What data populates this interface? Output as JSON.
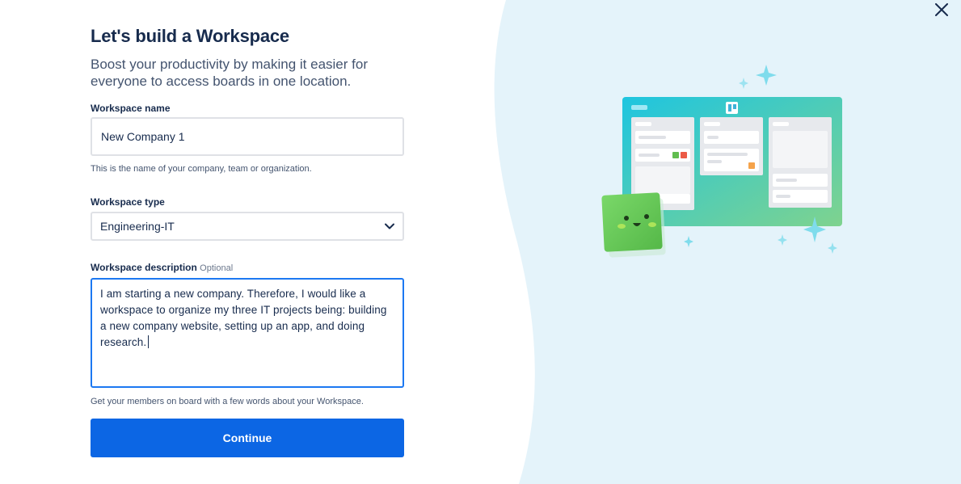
{
  "header": {
    "title": "Let's build a Workspace",
    "subtitle": "Boost your productivity by making it easier for everyone to access boards in one location."
  },
  "workspace_name": {
    "label": "Workspace name",
    "value": "New Company 1",
    "help": "This is the name of your company, team or organization."
  },
  "workspace_type": {
    "label": "Workspace type",
    "selected": "Engineering-IT"
  },
  "workspace_description": {
    "label": "Workspace description",
    "optional": "Optional",
    "value": "I am starting a new company. Therefore, I would like a workspace to organize my three IT projects being: building a new company website, setting up an app, and doing research.",
    "help": "Get your members on board with a few words about your Workspace."
  },
  "actions": {
    "continue_label": "Continue"
  },
  "icons": {
    "close": "close-icon",
    "chevron": "chevron-down-icon",
    "illustration": "trello-board-illustration"
  },
  "colors": {
    "primary": "#0c66e4",
    "focus_border": "#1c78f2",
    "panel_bg": "#e4f3fa",
    "board_gradient_start": "#1ec5e0",
    "board_gradient_end": "#7fd38e",
    "sparkle": "#7fdcec",
    "mascot": "#6bc950"
  }
}
